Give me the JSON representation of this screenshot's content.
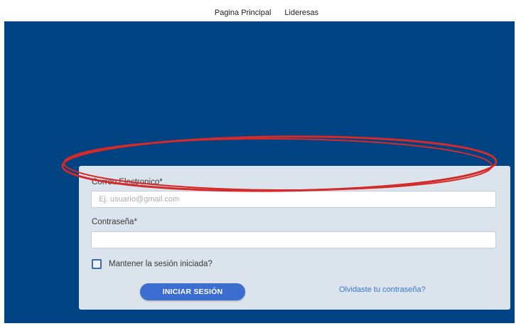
{
  "nav": {
    "home_label": "Pagina Principal",
    "leaders_label": "Lideresas"
  },
  "login": {
    "email_label": "Correo Electronico*",
    "email_placeholder": "Ej. usuario@gmail.com",
    "email_value": "",
    "password_label": "Contraseña*",
    "password_value": "",
    "remember_label": "Mantener la sesión iniciada?",
    "remember_checked": false,
    "submit_label": "INICIAR SESIÓN",
    "forgot_label": "Olvidaste tu contraseña?"
  },
  "colors": {
    "hero_background": "#004383",
    "card_background": "#dbe3ec",
    "button": "#3b6ecf",
    "link": "#3877c9",
    "annotation": "#d42a2a"
  },
  "annotation": {
    "shape": "ellipse",
    "highlights": "email-field"
  }
}
